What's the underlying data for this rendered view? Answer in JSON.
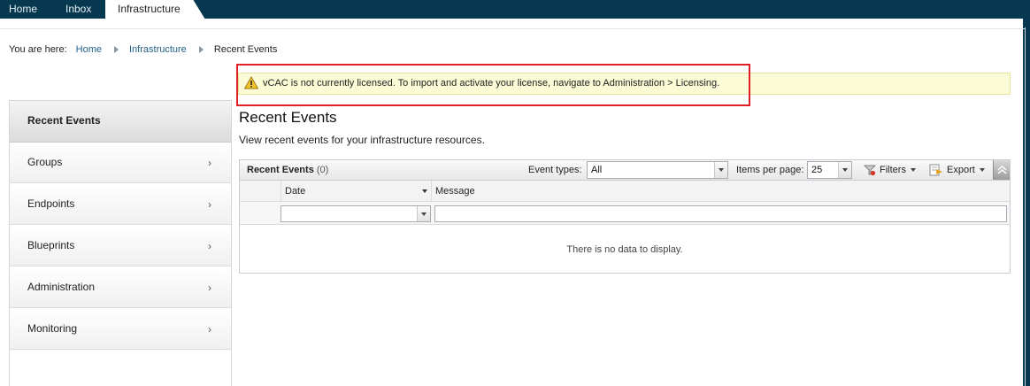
{
  "nav": {
    "tabs": [
      {
        "label": "Home"
      },
      {
        "label": "Inbox"
      },
      {
        "label": "Infrastructure"
      }
    ]
  },
  "breadcrumb": {
    "prefix": "You are here:",
    "items": [
      "Home",
      "Infrastructure",
      "Recent Events"
    ]
  },
  "warning": {
    "text": "vCAC is not currently licensed. To import and activate your license, navigate to Administration > Licensing."
  },
  "sidebar": {
    "header": "Recent Events",
    "items": [
      {
        "label": "Groups"
      },
      {
        "label": "Endpoints"
      },
      {
        "label": "Blueprints"
      },
      {
        "label": "Administration"
      },
      {
        "label": "Monitoring"
      }
    ]
  },
  "main": {
    "title": "Recent Events",
    "subtitle": "View recent events for your infrastructure resources."
  },
  "grid": {
    "title": "Recent Events",
    "count": "(0)",
    "event_types_label": "Event types:",
    "event_types_value": "All",
    "items_per_page_label": "Items per page:",
    "items_per_page_value": "25",
    "filters_label": "Filters",
    "export_label": "Export",
    "columns": [
      "Date",
      "Message"
    ],
    "empty_text": "There is no data to display."
  },
  "colors": {
    "topbar": "#063850",
    "link": "#205f86",
    "warning_bg": "#fbfbd6",
    "highlight_border": "#e01f26"
  }
}
